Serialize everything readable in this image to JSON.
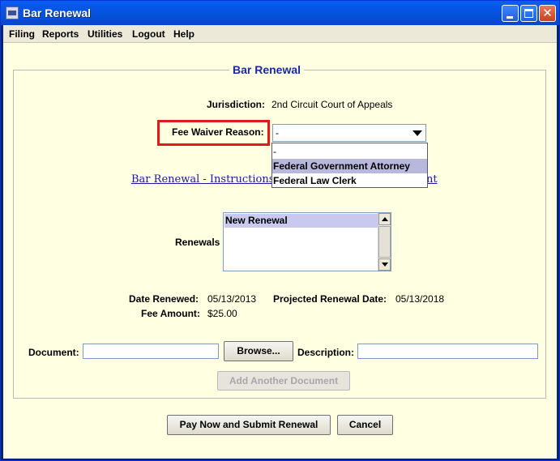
{
  "window": {
    "title": "Bar Renewal"
  },
  "menu": [
    "Filing",
    "Reports",
    "Utilities",
    "Logout",
    "Help"
  ],
  "panel": {
    "title": "Bar Renewal"
  },
  "jurisdiction": {
    "label": "Jurisdiction:",
    "value": "2nd Circuit Court of Appeals"
  },
  "fee_waiver": {
    "label": "Fee Waiver Reason:",
    "selected": "-",
    "options": [
      "-",
      "Federal Government Attorney",
      "Federal Law Clerk"
    ],
    "highlighted_option": "Federal Government Attorney"
  },
  "instructions_link": {
    "text_start": "Bar Renewal - Instructions for",
    "text_end": "nt"
  },
  "renewals": {
    "label": "Renewals",
    "items": [
      "New Renewal"
    ]
  },
  "dates": {
    "date_renewed_label": "Date Renewed:",
    "date_renewed": "05/13/2013",
    "projected_label": "Projected Renewal Date:",
    "projected": "05/13/2018",
    "fee_label": "Fee Amount:",
    "fee": "$25.00"
  },
  "document": {
    "label": "Document:",
    "value": "",
    "browse_label": "Browse...",
    "description_label": "Description:",
    "description_value": "",
    "add_label": "Add Another Document"
  },
  "actions": {
    "pay_label": "Pay Now and Submit Renewal",
    "cancel_label": "Cancel"
  },
  "colors": {
    "title_blue": "#1a2aa0",
    "highlight_red": "#e01b1b",
    "panel_bg": "#ffffe1"
  }
}
